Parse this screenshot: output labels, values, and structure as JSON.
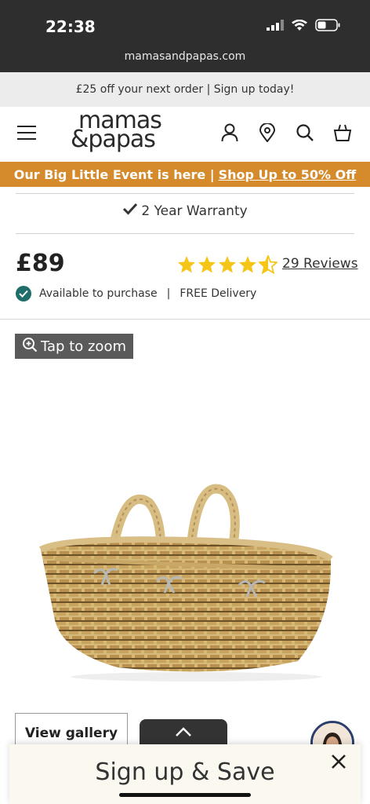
{
  "status_bar": {
    "time": "22:38",
    "url": "mamasandpapas.com",
    "icons": [
      "cellular-signal-icon",
      "wifi-icon",
      "battery-icon"
    ]
  },
  "promo": {
    "text": "£25 off your next order | Sign up today!"
  },
  "header": {
    "logo_line1": "mamas",
    "logo_line2": "&papas",
    "icons": [
      "menu-icon",
      "account-icon",
      "store-locator-icon",
      "search-icon",
      "basket-icon"
    ]
  },
  "event_banner": {
    "text": "Our Big Little Event is here |",
    "link": "Shop Up to 50% Off",
    "color": "#d58b2c"
  },
  "product": {
    "warranty": "2 Year Warranty",
    "price": "£89",
    "rating_stars": 4.5,
    "rating_max": 5,
    "reviews_link": "29 Reviews",
    "availability": "Available to purchase",
    "separator": "|",
    "delivery": "FREE Delivery",
    "zoom_label": "Tap to zoom",
    "gallery_label": "View gallery",
    "image_subject": "moses-basket-image"
  },
  "signup": {
    "title": "Sign up & Save",
    "close_icon": "close-icon"
  },
  "colors": {
    "status_bg": "#2e2e2e",
    "star": "#f5c518",
    "check": "#1f6e6a",
    "event": "#d58b2c"
  }
}
